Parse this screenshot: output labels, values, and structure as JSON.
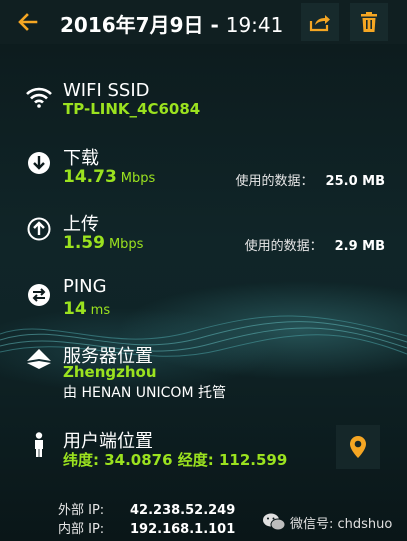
{
  "header": {
    "date": "2016年7月9日",
    "separator": " - ",
    "time": "19:41"
  },
  "wifi": {
    "label": "WIFI SSID",
    "ssid": "TP-LINK_4C6084"
  },
  "download": {
    "label": "下载",
    "value": "14.73",
    "unit": "Mbps",
    "data_used_label": "使用的数据：",
    "data_used": "25.0 MB"
  },
  "upload": {
    "label": "上传",
    "value": "1.59",
    "unit": "Mbps",
    "data_used_label": "使用的数据：",
    "data_used": "2.9 MB"
  },
  "ping": {
    "label": "PING",
    "value": "14",
    "unit": "ms"
  },
  "server": {
    "label": "服务器位置",
    "city": "Zhengzhou",
    "host": "由 HENAN UNICOM 托管"
  },
  "client": {
    "label": "用户端位置",
    "coords": "纬度: 34.0876  经度: 112.599"
  },
  "ips": {
    "external_label": "外部 IP:",
    "external": "42.238.52.249",
    "internal_label": "内部 IP:",
    "internal": "192.168.1.101"
  },
  "watermark": {
    "text": "微信号: chdshuo"
  },
  "colors": {
    "accent_orange": "#f5a623",
    "value_green": "#9be21f",
    "background": "#0d1b1d"
  },
  "icons": {
    "back": "arrow-left-icon",
    "share": "share-icon",
    "delete": "trash-icon",
    "wifi": "wifi-icon",
    "download": "download-icon",
    "upload": "upload-icon",
    "ping": "ping-icon",
    "server": "server-location-icon",
    "client": "person-icon",
    "locate": "map-pin-icon"
  }
}
